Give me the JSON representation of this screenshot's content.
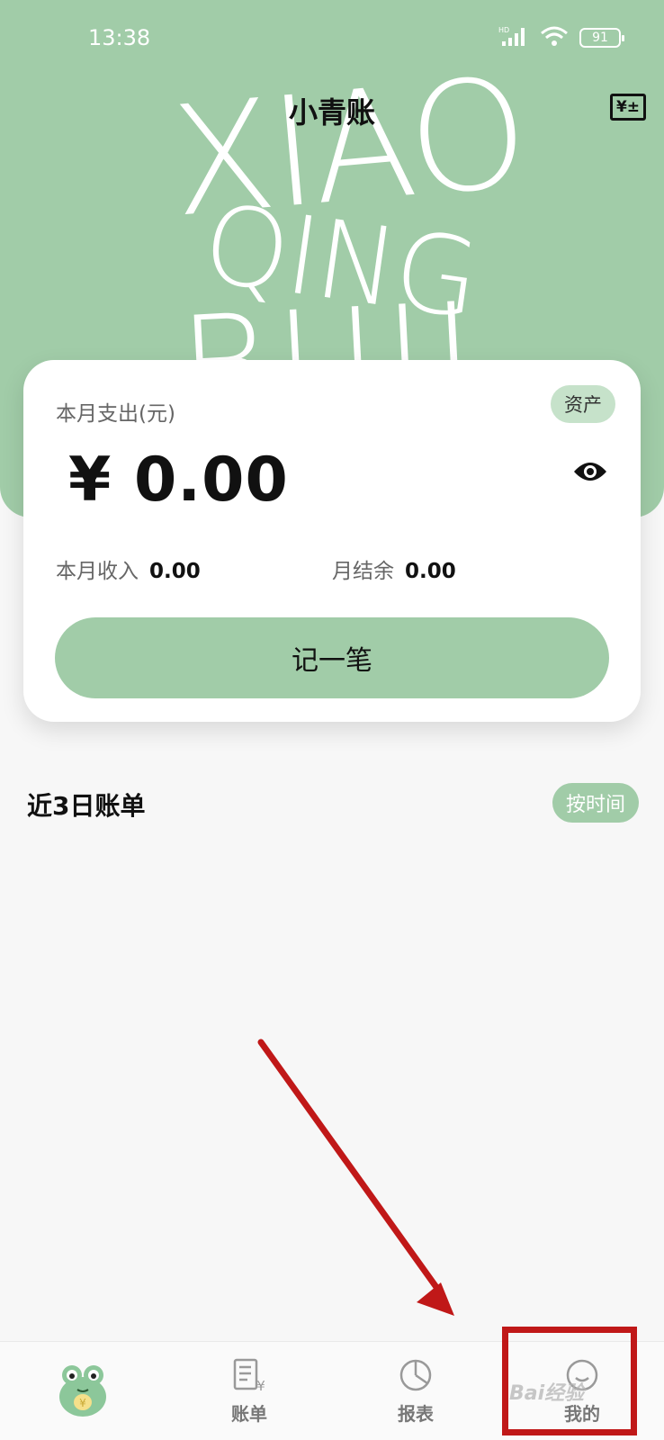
{
  "status_bar": {
    "time": "13:38",
    "battery": "91",
    "network": "HD"
  },
  "header": {
    "title": "小青账",
    "bg_words": [
      "XIAO",
      "QING",
      "BUJI"
    ]
  },
  "card": {
    "label": "本月支出(元)",
    "asset_button": "资产",
    "amount": "¥ 0.00",
    "income_label": "本月收入",
    "income_value": "0.00",
    "balance_label": "月结余",
    "balance_value": "0.00",
    "record_button": "记一笔"
  },
  "recent": {
    "title": "近3日账单",
    "sort_button": "按时间"
  },
  "tabs": [
    {
      "label": "",
      "icon": "frog-mascot-icon"
    },
    {
      "label": "账单",
      "icon": "bill-icon"
    },
    {
      "label": "报表",
      "icon": "pie-chart-icon"
    },
    {
      "label": "我的",
      "icon": "smile-icon"
    }
  ],
  "watermark": "Bai经验",
  "colors": {
    "accent": "#a1cca8",
    "accent_light": "#c6e2ca",
    "annotation": "#c01818"
  }
}
